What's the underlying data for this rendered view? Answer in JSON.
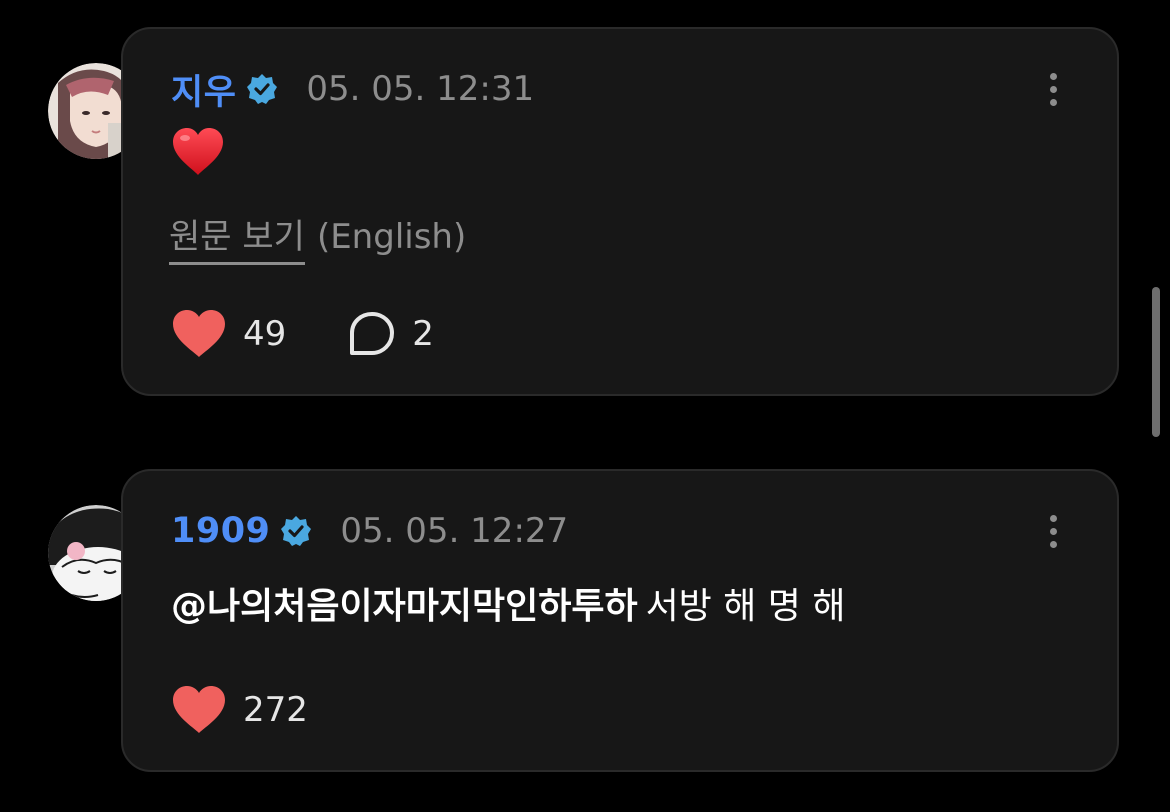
{
  "comments": [
    {
      "username": "지우",
      "verified": true,
      "timestamp": "05. 05. 12:31",
      "body_emoji": "❤️",
      "translate_link": "원문 보기",
      "translate_lang": "(English)",
      "like_count": "49",
      "reply_count": "2"
    },
    {
      "username": "1909",
      "verified": true,
      "timestamp": "05. 05. 12:27",
      "mention": "@나의처음이자마지막인하투하",
      "message": "서방 해 명 해",
      "like_count": "272"
    }
  ],
  "colors": {
    "background": "#000000",
    "card": "#171717",
    "username": "#4f8ef7",
    "verified_badge": "#4aa8e0",
    "like_heart": "#f0615e",
    "muted_text": "#8d8d8d"
  },
  "icons": {
    "verified": "verified-badge-icon",
    "like": "heart-icon",
    "reply": "speech-bubble-icon",
    "more": "vertical-ellipsis-icon"
  }
}
